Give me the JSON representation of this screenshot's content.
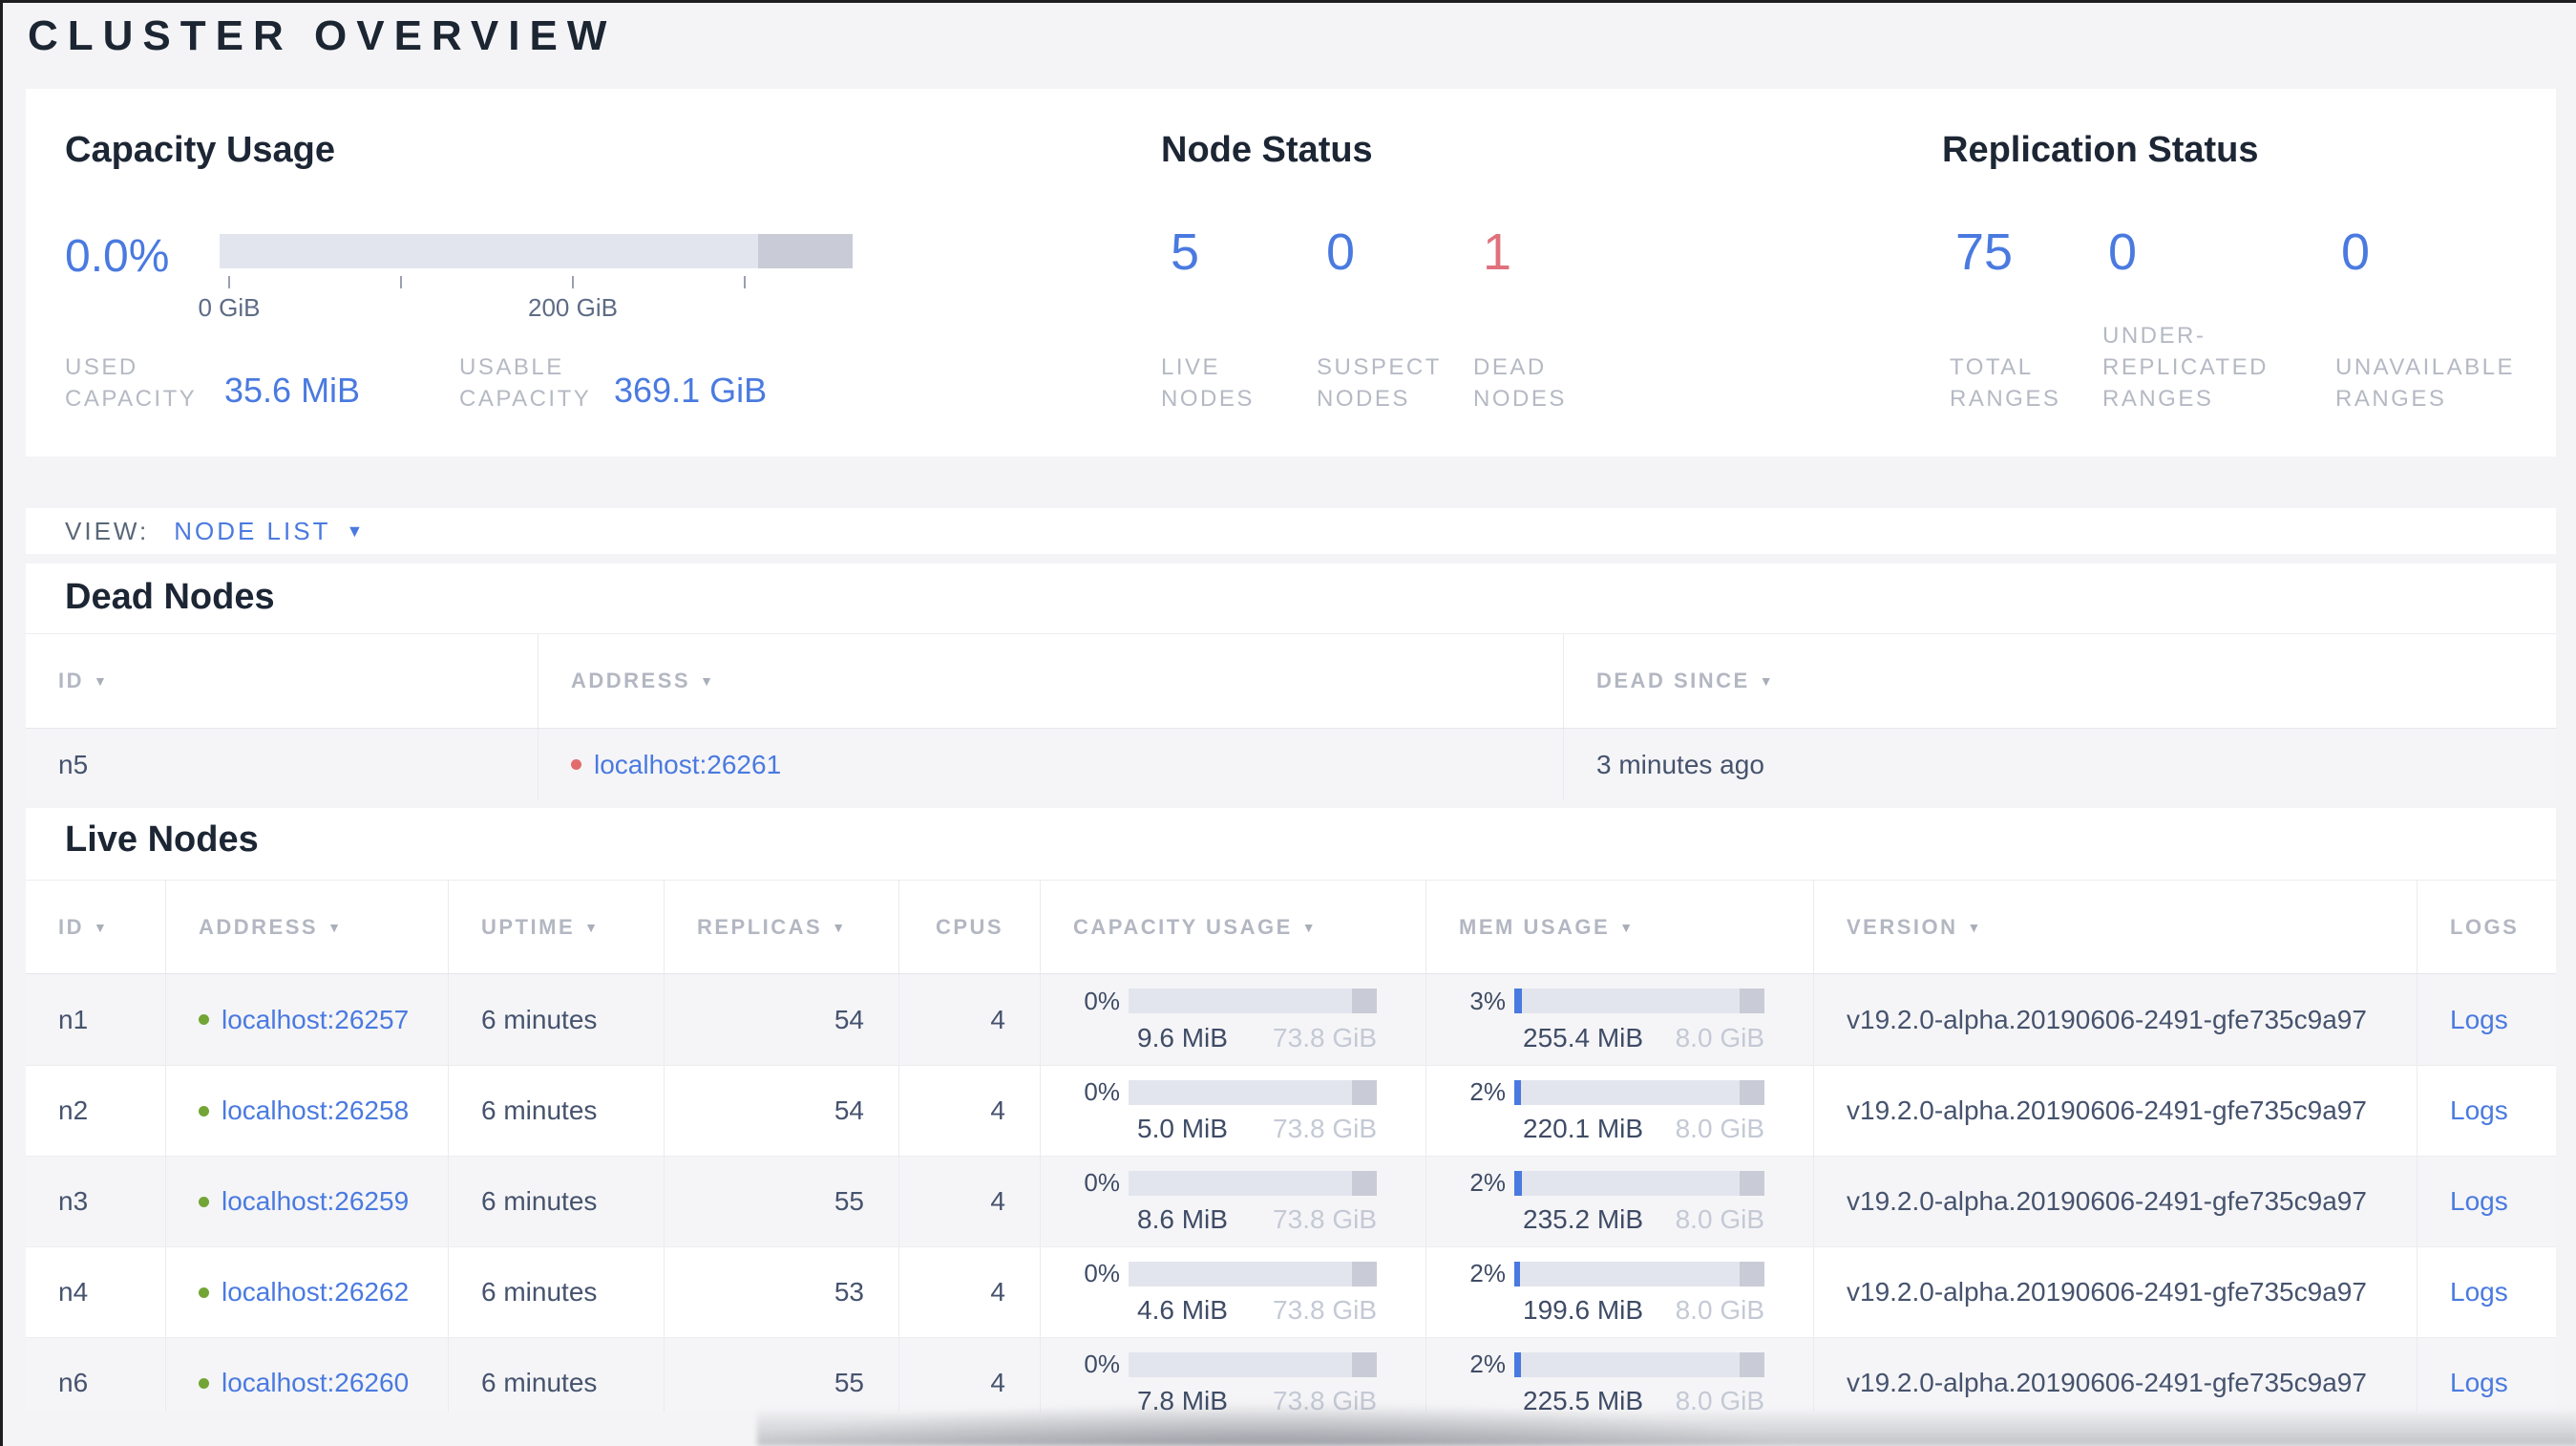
{
  "page": {
    "title": "CLUSTER OVERVIEW"
  },
  "icons": {
    "sort_arrow": "▼",
    "dropdown_arrow": "▼"
  },
  "colors": {
    "accent_blue": "#4a7ae0",
    "dead_red": "#e0717c",
    "live_dot_green": "#72a535",
    "dead_dot_red": "#e26b6b"
  },
  "summary": {
    "capacity": {
      "title": "Capacity Usage",
      "percent": "0.0%",
      "bar": {
        "fill_pct": 0,
        "other_pct": 15
      },
      "tick_labels": [
        "0 GiB",
        "200 GiB"
      ],
      "stats": [
        {
          "label": "USED CAPACITY",
          "value": "35.6 MiB"
        },
        {
          "label": "USABLE CAPACITY",
          "value": "369.1 GiB"
        }
      ]
    },
    "node_status": {
      "title": "Node Status",
      "stats": [
        {
          "value": "5",
          "label": "LIVE NODES"
        },
        {
          "value": "0",
          "label": "SUSPECT NODES"
        },
        {
          "value": "1",
          "label": "DEAD NODES"
        }
      ]
    },
    "replication": {
      "title": "Replication Status",
      "stats": [
        {
          "value": "75",
          "label": "TOTAL RANGES"
        },
        {
          "value": "0",
          "label": "UNDER-REPLICATED RANGES"
        },
        {
          "value": "0",
          "label": "UNAVAILABLE RANGES"
        }
      ]
    }
  },
  "view_bar": {
    "label": "VIEW:",
    "selected": "NODE LIST"
  },
  "dead_nodes": {
    "title": "Dead Nodes",
    "columns": [
      "ID",
      "ADDRESS",
      "DEAD SINCE"
    ],
    "rows": [
      {
        "id": "n5",
        "address": "localhost:26261",
        "dead_since": "3 minutes ago"
      }
    ]
  },
  "live_nodes": {
    "title": "Live Nodes",
    "columns": [
      "ID",
      "ADDRESS",
      "UPTIME",
      "REPLICAS",
      "CPUS",
      "CAPACITY USAGE",
      "MEM USAGE",
      "VERSION",
      "LOGS"
    ],
    "rows": [
      {
        "id": "n1",
        "address": "localhost:26257",
        "uptime": "6 minutes",
        "replicas": "54",
        "cpus": "4",
        "capacity": {
          "pct": "0%",
          "used": "9.6 MiB",
          "total": "73.8 GiB",
          "fill": 0
        },
        "mem": {
          "pct": "3%",
          "used": "255.4 MiB",
          "total": "8.0 GiB",
          "fill": 3
        },
        "version": "v19.2.0-alpha.20190606-2491-gfe735c9a97",
        "logs": "Logs"
      },
      {
        "id": "n2",
        "address": "localhost:26258",
        "uptime": "6 minutes",
        "replicas": "54",
        "cpus": "4",
        "capacity": {
          "pct": "0%",
          "used": "5.0 MiB",
          "total": "73.8 GiB",
          "fill": 0
        },
        "mem": {
          "pct": "2%",
          "used": "220.1 MiB",
          "total": "8.0 GiB",
          "fill": 2.7
        },
        "version": "v19.2.0-alpha.20190606-2491-gfe735c9a97",
        "logs": "Logs"
      },
      {
        "id": "n3",
        "address": "localhost:26259",
        "uptime": "6 minutes",
        "replicas": "55",
        "cpus": "4",
        "capacity": {
          "pct": "0%",
          "used": "8.6 MiB",
          "total": "73.8 GiB",
          "fill": 0
        },
        "mem": {
          "pct": "2%",
          "used": "235.2 MiB",
          "total": "8.0 GiB",
          "fill": 2.9
        },
        "version": "v19.2.0-alpha.20190606-2491-gfe735c9a97",
        "logs": "Logs"
      },
      {
        "id": "n4",
        "address": "localhost:26262",
        "uptime": "6 minutes",
        "replicas": "53",
        "cpus": "4",
        "capacity": {
          "pct": "0%",
          "used": "4.6 MiB",
          "total": "73.8 GiB",
          "fill": 0
        },
        "mem": {
          "pct": "2%",
          "used": "199.6 MiB",
          "total": "8.0 GiB",
          "fill": 2.4
        },
        "version": "v19.2.0-alpha.20190606-2491-gfe735c9a97",
        "logs": "Logs"
      },
      {
        "id": "n6",
        "address": "localhost:26260",
        "uptime": "6 minutes",
        "replicas": "55",
        "cpus": "4",
        "capacity": {
          "pct": "0%",
          "used": "7.8 MiB",
          "total": "73.8 GiB",
          "fill": 0
        },
        "mem": {
          "pct": "2%",
          "used": "225.5 MiB",
          "total": "8.0 GiB",
          "fill": 2.8
        },
        "version": "v19.2.0-alpha.20190606-2491-gfe735c9a97",
        "logs": "Logs"
      }
    ]
  }
}
